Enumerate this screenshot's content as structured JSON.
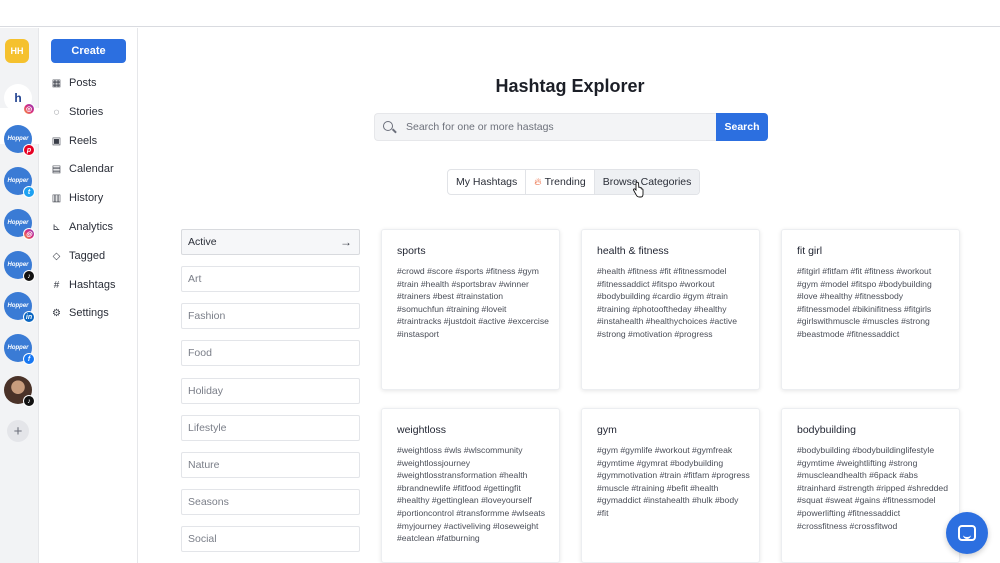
{
  "workspace": {
    "initials": "HH"
  },
  "accounts": [
    {
      "name": "instagram-account-hh",
      "text": "h",
      "badge": "ig"
    },
    {
      "name": "pinterest-account",
      "text": "Hopper",
      "badge": "pin"
    },
    {
      "name": "twitter-account",
      "text": "Hopper",
      "badge": "tw"
    },
    {
      "name": "instagram-account",
      "text": "Hopper",
      "badge": "ig"
    },
    {
      "name": "tiktok-account",
      "text": "Hopper",
      "badge": "tt"
    },
    {
      "name": "linkedin-account",
      "text": "Hopper",
      "badge": "li"
    },
    {
      "name": "facebook-account",
      "text": "Hopper",
      "badge": "fb"
    }
  ],
  "nav": {
    "create_label": "Create",
    "items": [
      {
        "label": "Posts",
        "icon": "grid-icon"
      },
      {
        "label": "Stories",
        "icon": "stories-icon"
      },
      {
        "label": "Reels",
        "icon": "reels-icon"
      },
      {
        "label": "Calendar",
        "icon": "calendar-icon"
      },
      {
        "label": "History",
        "icon": "history-icon"
      },
      {
        "label": "Analytics",
        "icon": "analytics-icon"
      },
      {
        "label": "Tagged",
        "icon": "tag-icon"
      },
      {
        "label": "Hashtags",
        "icon": "hash-icon"
      },
      {
        "label": "Settings",
        "icon": "gear-icon"
      }
    ]
  },
  "page": {
    "title": "Hashtag Explorer",
    "search_placeholder": "Search for one or more hastags",
    "search_button": "Search"
  },
  "tabs": [
    "My Hashtags",
    "Trending",
    "Browse Categories"
  ],
  "categories": [
    "Active",
    "Art",
    "Fashion",
    "Food",
    "Holiday",
    "Lifestyle",
    "Nature",
    "Seasons",
    "Social"
  ],
  "cards": [
    {
      "title": "sports",
      "tags": "#crowd #score #sports #fitness #gym #train #health #sportsbrav #winner #trainers #best #trainstation #somuchfun #training #loveit #traintracks #justdoit #active #excercise #instasport"
    },
    {
      "title": "health & fitness",
      "tags": "#health #fitness #fit #fitnessmodel #fitnessaddict #fitspo #workout #bodybuilding #cardio #gym #train #training #photooftheday #healthy #instahealth #healthychoices #active #strong #motivation #progress"
    },
    {
      "title": "fit girl",
      "tags": "#fitgirl #fitfam #fit #fitness #workout #gym #model #fitspo #bodybuilding #love #healthy #fitnessbody #fitnessmodel #bikinifitness #fitgirls #girlswithmuscle #muscles #strong #beastmode #fitnessaddict"
    },
    {
      "title": "weightloss",
      "tags": "#weightloss #wls #wlscommunity #weightlossjourney #weightlosstransformation #health #brandnewlife #fitfood #gettingfit #healthy #gettinglean #loveyourself #portioncontrol #transformme #wlseats #myjourney #activeliving #loseweight #eatclean #fatburning"
    },
    {
      "title": "gym",
      "tags": "#gym #gymlife #workout #gymfreak #gymtime #gymrat #bodybuilding #gymmotivation #train #fitfam #progress #muscle #training #befit #health #gymaddict #instahealth #hulk #body #fit"
    },
    {
      "title": "bodybuilding",
      "tags": "#bodybuilding #bodybuildinglifestyle #gymtime #weightlifting #strong #muscleandhealth #6pack #abs #trainhard #strength #ripped #shredded #squat #sweat #gains #fitnessmodel #powerlifting #fitnessaddict #crossfitness #crossfitwod"
    }
  ],
  "colors": {
    "accent": "#2c6fe0",
    "workspace": "#f5c12e"
  }
}
